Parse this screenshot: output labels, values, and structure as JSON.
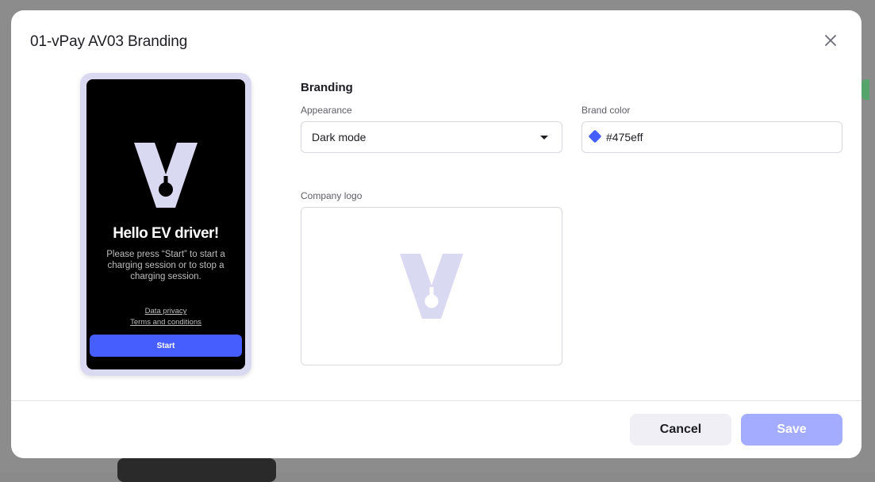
{
  "modal": {
    "title": "01-vPay AV03 Branding"
  },
  "preview": {
    "greeting": "Hello EV driver!",
    "description": "Please press “Start” to start a charging session or to stop a charging session.",
    "links": [
      "Data privacy",
      "Terms and conditions"
    ],
    "start_label": "Start",
    "logo_icon": "v-logo-icon",
    "logo_color": "#dad9f2"
  },
  "branding": {
    "section_title": "Branding",
    "appearance": {
      "label": "Appearance",
      "value": "Dark mode"
    },
    "brand_color": {
      "label": "Brand color",
      "value": "#475eff",
      "display": "#475eff"
    },
    "company_logo": {
      "label": "Company logo",
      "icon": "v-logo-icon"
    }
  },
  "footer": {
    "cancel_label": "Cancel",
    "save_label": "Save"
  },
  "colors": {
    "accent": "#475eff",
    "save_disabled": "#a3acff",
    "logo_tint": "#dad9f2"
  }
}
